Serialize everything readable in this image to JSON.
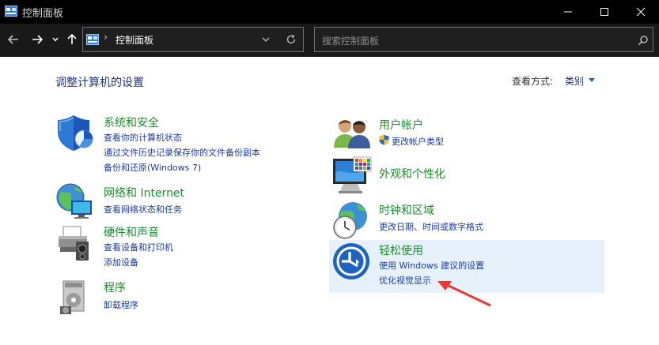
{
  "window": {
    "title": "控制面板"
  },
  "address": {
    "path": "控制面板",
    "separator": "›"
  },
  "search": {
    "placeholder": "搜索控制面板"
  },
  "header": {
    "title": "调整计算机的设置",
    "view_label": "查看方式:",
    "view_value": "类别"
  },
  "categories": [
    {
      "title": "系统和安全",
      "icon": "shield-icon",
      "links": [
        "查看你的计算机状态",
        "通过文件历史记录保存你的文件备份副本",
        "备份和还原(Windows 7)"
      ]
    },
    {
      "title": "网络和 Internet",
      "icon": "network-globe-icon",
      "links": [
        "查看网络状态和任务"
      ]
    },
    {
      "title": "硬件和声音",
      "icon": "printer-icon",
      "links": [
        "查看设备和打印机",
        "添加设备"
      ]
    },
    {
      "title": "程序",
      "icon": "program-disc-icon",
      "links": [
        "卸载程序"
      ]
    },
    {
      "title": "用户帐户",
      "icon": "users-icon",
      "links": [
        "更改帐户类型"
      ]
    },
    {
      "title": "外观和个性化",
      "icon": "monitor-palette-icon",
      "links": []
    },
    {
      "title": "时钟和区域",
      "icon": "clock-globe-icon",
      "links": [
        "更改日期、时间或数字格式"
      ]
    },
    {
      "title": "轻松使用",
      "icon": "ease-of-access-icon",
      "links": [
        "使用 Windows 建议的设置",
        "优化视觉显示"
      ]
    }
  ],
  "colors": {
    "category_title": "#1e8a2e",
    "link": "#1a3b9a",
    "highlight": "#e6f1fb",
    "annotation_arrow": "#e53935"
  }
}
